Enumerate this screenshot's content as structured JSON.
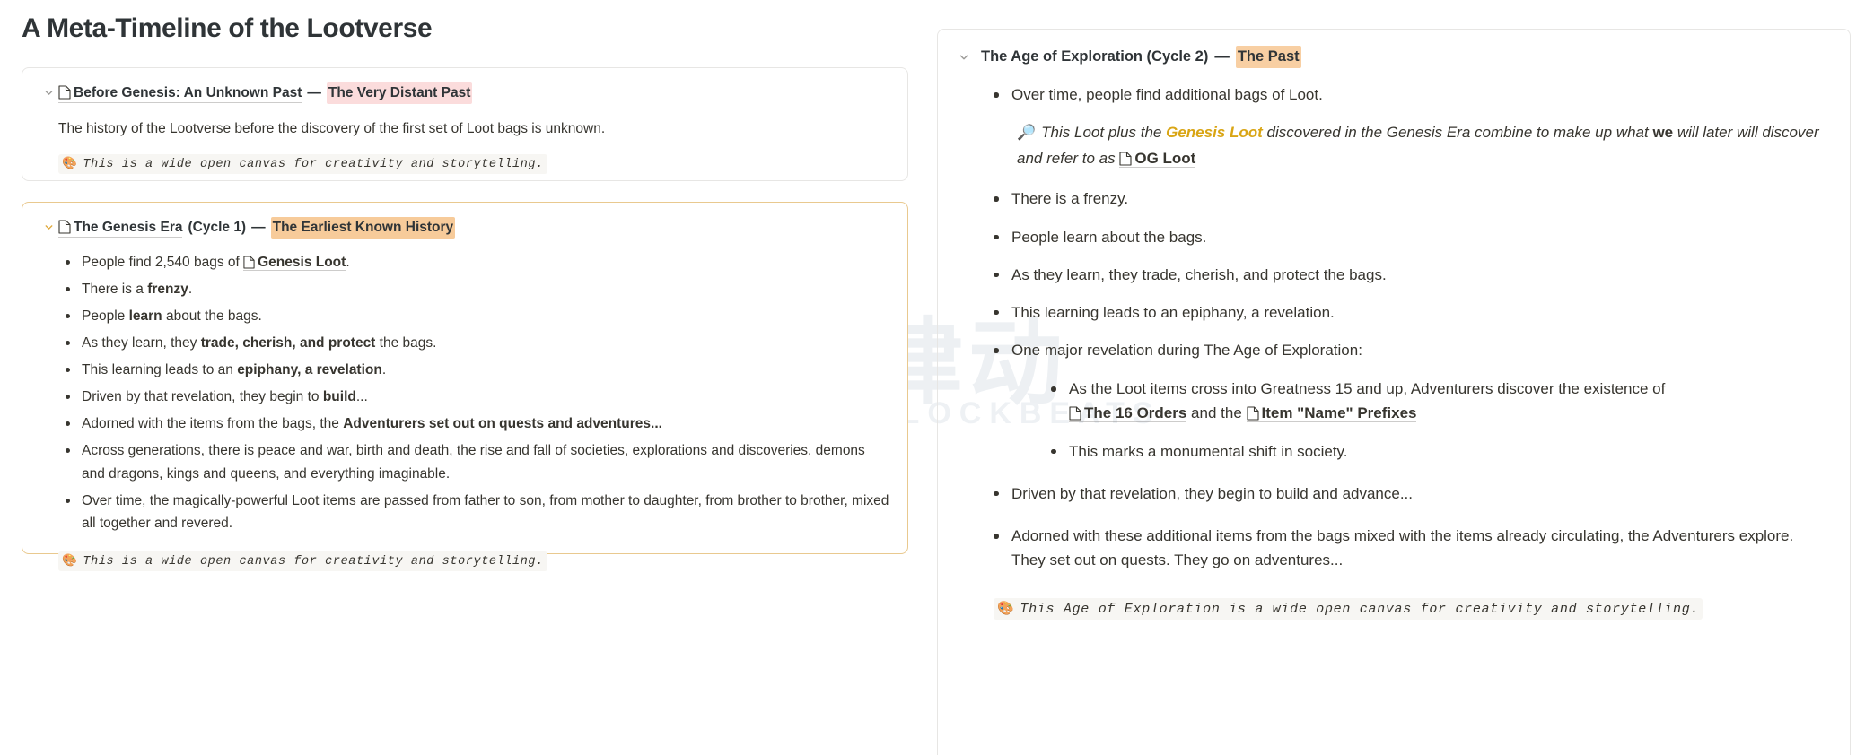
{
  "document": {
    "title": "A Meta-Timeline of the Lootverse"
  },
  "watermark": {
    "cjk": "律动",
    "word": "BLOCKBEATS"
  },
  "colors": {
    "highlight_pink": "#fbdcdc",
    "highlight_orange": "#f7cb9a",
    "gold_accent": "#d9a514",
    "card_border_default": "#e7e6e4",
    "card_border_amber": "#e9c98f",
    "callout_background": "#f7f6f3"
  },
  "left": {
    "cards": [
      {
        "chevron_icon": "chevron-down-icon",
        "doc_icon": "page-doc-icon",
        "title": "Before Genesis: An Unknown Past",
        "dash": "—",
        "tag": "The Very Distant Past",
        "tag_color": "pink",
        "paragraph": "The history of the Lootverse before the discovery of the first set of Loot bags is unknown.",
        "callout_emoji": "🎨",
        "callout": "This is a wide open canvas for creativity and storytelling."
      },
      {
        "chevron_icon": "chevron-down-icon",
        "doc_icon": "page-doc-icon",
        "title": "The Genesis Era",
        "cycle": "(Cycle 1)",
        "dash": "—",
        "tag": "The Earliest Known History",
        "tag_color": "orange",
        "bullets": [
          {
            "pre": "People find 2,540 bags of ",
            "ref": "Genesis Loot",
            "post": "."
          },
          {
            "pre": "There is a ",
            "bold": "frenzy",
            "post": "."
          },
          {
            "pre": "People ",
            "bold": "learn",
            "post": " about the bags."
          },
          {
            "pre": "As they learn, they ",
            "bold": "trade, cherish, and protect",
            "post": " the bags."
          },
          {
            "pre": "This learning leads to an ",
            "bold": "epiphany, a revelation",
            "post": "."
          },
          {
            "pre": "Driven by that revelation, they begin to ",
            "bold": "build",
            "post": "..."
          },
          {
            "pre": "Adorned with the items from the bags, the ",
            "bold": "Adventurers set out on quests and adventures...",
            "post": ""
          },
          {
            "pre": "Across generations, there is peace and war, birth and death, the rise and fall of societies, explorations and discoveries, demons and dragons, kings and queens, and everything imaginable.",
            "post": ""
          },
          {
            "pre": "Over time, the magically-powerful Loot items are passed from father to son, from mother to daughter, from brother to brother, mixed all together and revered.",
            "post": ""
          }
        ],
        "callout_emoji": "🎨",
        "callout": "This is a wide open canvas for creativity and storytelling."
      }
    ]
  },
  "right": {
    "chevron_icon": "chevron-down-icon",
    "title": "The Age of Exploration (Cycle 2)",
    "dash": "—",
    "tag": "The Past",
    "tag_color": "orange",
    "bullet_1": "Over time, people find additional bags of Loot.",
    "quote": {
      "emoji": "🔎",
      "p1": "This Loot plus the ",
      "gold": "Genesis Loot",
      "p2": " discovered in the Genesis Era combine to make up what ",
      "bold": "we",
      "p3": " will later will discover and refer to as ",
      "ref_icon": "page-doc-icon",
      "ref": "OG Loot"
    },
    "bullets_mid": [
      "There is a frenzy.",
      "People learn about the bags.",
      "As they learn, they trade, cherish, and protect the bags.",
      "This learning leads to an epiphany, a revelation."
    ],
    "revelation_heading": "One major revelation during The Age of Exploration:",
    "revelation_sub": {
      "lead": "As the Loot items cross into Greatness 15 and up, Adventurers discover the existence of ",
      "ref_1": "The 16 Orders",
      "mid": " and the ",
      "ref_2": "Item \"Name\" Prefixes",
      "second": "This marks a monumental shift in society."
    },
    "bullets_end": [
      "Driven by that revelation, they begin to build and advance...",
      "Adorned with these additional items from the bags mixed with the items already circulating, the Adventurers explore. They set out on quests.  They go on adventures..."
    ],
    "callout_emoji": "🎨",
    "callout": "This Age of Exploration is a wide open canvas for creativity and storytelling."
  }
}
